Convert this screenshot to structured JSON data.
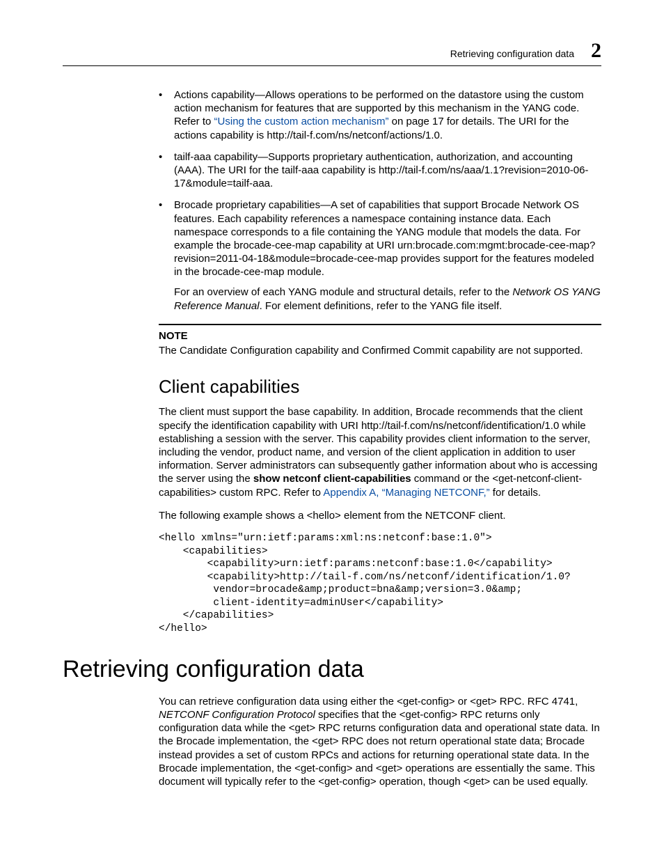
{
  "header": {
    "title": "Retrieving configuration data",
    "chapter": "2"
  },
  "bullets": {
    "b1": {
      "pre": "Actions capability—Allows operations to be performed on the datastore using the custom action mechanism for features that are supported by this mechanism in the YANG code. Refer to ",
      "link": "“Using the custom action mechanism”",
      "post": " on page 17 for details. The URI for the actions capability is http://tail-f.com/ns/netconf/actions/1.0."
    },
    "b2": "tailf-aaa capability—Supports proprietary authentication, authorization, and accounting (AAA). The URI for the tailf-aaa capability is http://tail-f.com/ns/aaa/1.1?revision=2010-06-17&module=tailf-aaa.",
    "b3": {
      "p": "Brocade proprietary capabilities—A set of capabilities that support Brocade Network OS features. Each capability references a namespace containing instance data. Each namespace corresponds to a file containing the YANG module that models the data. For example the brocade-cee-map capability at URI urn:brocade.com:mgmt:brocade-cee-map?revision=2011-04-18&module=brocade-cee-map provides support for the features modeled in the brocade-cee-map module.",
      "sub_pre": "For an overview of each YANG module and structural details, refer to the ",
      "sub_italic": "Network OS YANG Reference Manual",
      "sub_post": ". For element definitions, refer to the YANG file itself."
    }
  },
  "note": {
    "label": "NOTE",
    "text": "The Candidate Configuration capability and Confirmed Commit capability are not supported."
  },
  "client": {
    "heading": "Client capabilities",
    "p1_pre": "The client must support the base capability. In addition, Brocade recommends that the client specify the identification capability with URI http://tail-f.com/ns/netconf/identification/1.0 while establishing a session with the server. This capability provides client information to the server, including the vendor, product name, and version of the client application in addition to user information. Server administrators can subsequently gather information about who is accessing the server using the ",
    "p1_bold": "show netconf client-capabilities",
    "p1_mid": " command or the <get-netconf-client-capabilities> custom RPC. Refer to ",
    "p1_link": "Appendix A, “Managing NETCONF,”",
    "p1_post": " for details.",
    "p2": "The following example shows a <hello> element from the NETCONF client.",
    "code": "<hello xmlns=\"urn:ietf:params:xml:ns:netconf:base:1.0\">\n    <capabilities>\n        <capability>urn:ietf:params:netconf:base:1.0</capability>\n        <capability>http://tail-f.com/ns/netconf/identification/1.0?\n         vendor=brocade&amp;product=bna&amp;version=3.0&amp;\n         client-identity=adminUser</capability>\n    </capabilities>\n</hello>"
  },
  "retrieve": {
    "heading": "Retrieving configuration data",
    "p_pre": "You can retrieve configuration data using either the <get-config> or <get> RPC. RFC 4741, ",
    "p_italic": "NETCONF Configuration Protocol",
    "p_post": " specifies that the <get-config> RPC returns only configuration data while the <get> RPC returns configuration data and operational state data. In the Brocade implementation, the <get> RPC does not return operational state data; Brocade instead provides a set of custom RPCs and actions for returning operational state data. In the Brocade implementation, the <get-config> and <get> operations are essentially the same. This document will typically refer to the <get-config> operation, though <get> can be used equally."
  }
}
